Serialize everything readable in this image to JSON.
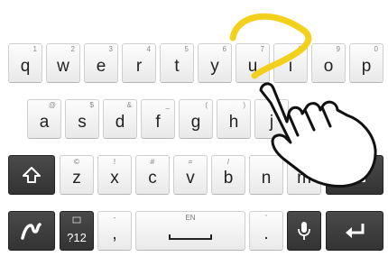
{
  "keyboard": {
    "row1": [
      {
        "label": "q",
        "hint": "1"
      },
      {
        "label": "w",
        "hint": "2"
      },
      {
        "label": "e",
        "hint": "3"
      },
      {
        "label": "r",
        "hint": "4"
      },
      {
        "label": "t",
        "hint": "5"
      },
      {
        "label": "y",
        "hint": "6"
      },
      {
        "label": "u",
        "hint": "7"
      },
      {
        "label": "i",
        "hint": "8"
      },
      {
        "label": "o",
        "hint": "9"
      },
      {
        "label": "p",
        "hint": "0"
      }
    ],
    "row2": [
      {
        "label": "a",
        "hint": "@"
      },
      {
        "label": "s",
        "hint": "$"
      },
      {
        "label": "d",
        "hint": "&"
      },
      {
        "label": "f",
        "hint": "_"
      },
      {
        "label": "g",
        "hint": "("
      },
      {
        "label": "h",
        "hint": ")"
      },
      {
        "label": "j",
        "hint": ""
      }
    ],
    "row3": [
      {
        "label": "z",
        "hint": "©"
      },
      {
        "label": "x",
        "hint": "!"
      },
      {
        "label": "c",
        "hint": "#"
      },
      {
        "label": "v",
        "hint": "="
      },
      {
        "label": "b",
        "hint": "/"
      },
      {
        "label": "n",
        "hint": ""
      },
      {
        "label": "m",
        "hint": ""
      }
    ],
    "symbols_label": "?12",
    "comma_label": ",",
    "comma_hint": "-",
    "space_hint": "EN",
    "period_label": ".",
    "period_hint": "'"
  },
  "icons": {
    "shift": "shift-arrow-icon",
    "swype": "swype-logo-icon",
    "emoji": "emoticon-icon",
    "mic": "microphone-icon",
    "enter": "enter-arrow-icon",
    "backspace": "backspace-icon",
    "gesture": "gesture-trail-icon",
    "hand": "pointing-hand-icon"
  },
  "colors": {
    "gesture_trail": "#f2d01c",
    "dark_key": "#3a3a3a",
    "light_key": "#f3f3f3"
  }
}
